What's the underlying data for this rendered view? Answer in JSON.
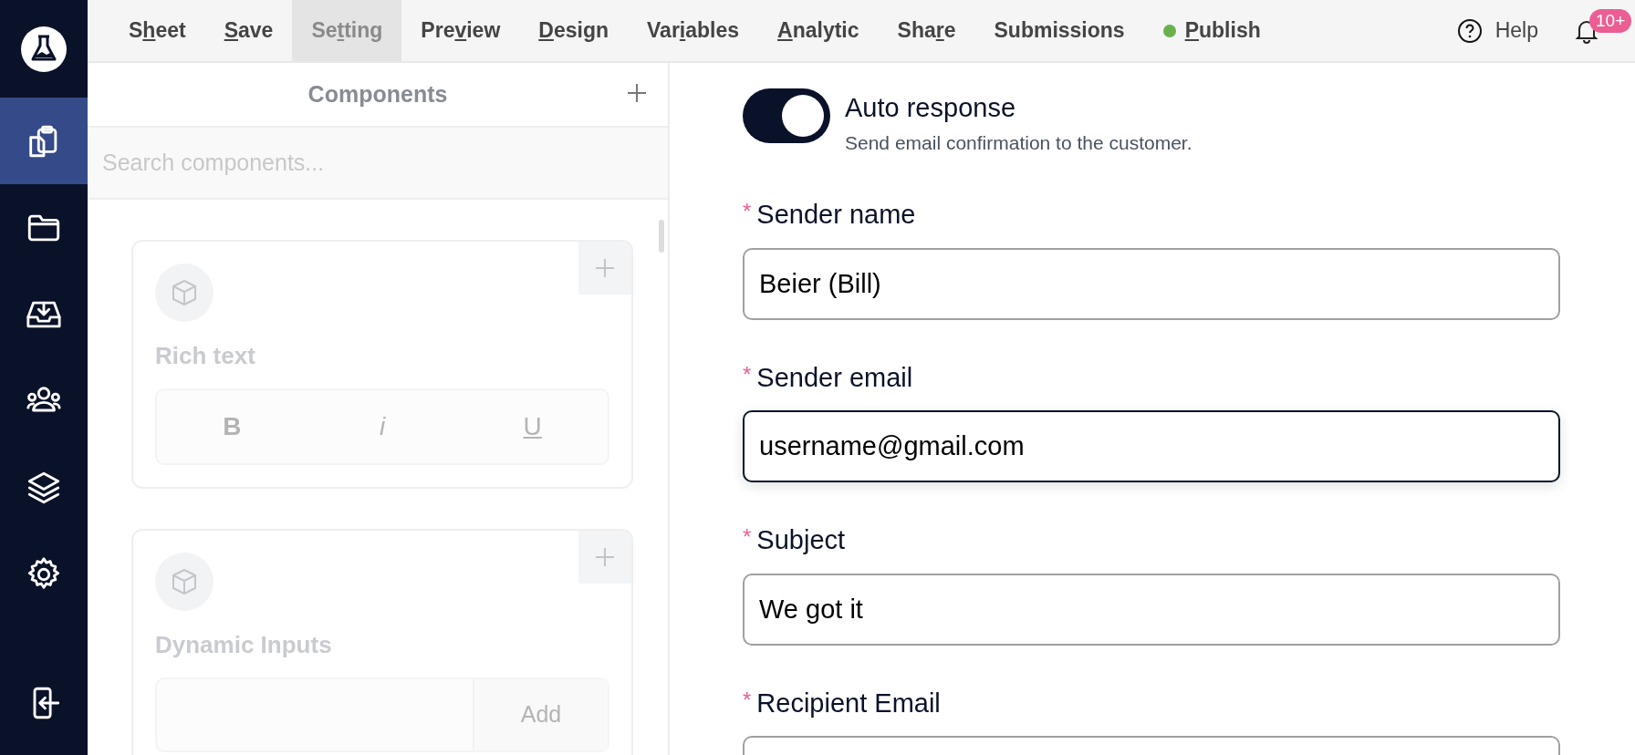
{
  "sidebar": {
    "items": [
      {
        "selected": true
      },
      {
        "selected": false
      },
      {
        "selected": false
      },
      {
        "selected": false
      },
      {
        "selected": false
      },
      {
        "selected": false
      }
    ]
  },
  "menu": [
    {
      "label_start": "S",
      "access_key": "h",
      "label_end": "eet",
      "selected": false
    },
    {
      "access_key": "S",
      "label_end": "ave",
      "selected": false
    },
    {
      "label_start": "Se",
      "access_key": "t",
      "label_end": "ting",
      "selected": true
    },
    {
      "label_start": "Pre",
      "access_key": "v",
      "label_end": "iew",
      "selected": false
    },
    {
      "access_key": "D",
      "label_end": "esign",
      "selected": false
    },
    {
      "label_start": "Var",
      "access_key": "i",
      "label_end": "ables",
      "selected": false
    },
    {
      "access_key": "A",
      "label_end": "nalytic",
      "selected": false
    },
    {
      "label_start": "Sha",
      "access_key": "r",
      "label_end": "e",
      "selected": false
    },
    {
      "label_start": "Submissions",
      "selected": false
    },
    {
      "access_key": "P",
      "label_end": "ublish",
      "selected": false,
      "color": "#6ab04c"
    }
  ],
  "help": {
    "label": "Help"
  },
  "notifications": {
    "badge": "10+"
  },
  "components_panel": {
    "title": "Components",
    "search": {
      "placeholder": "Search components..."
    },
    "cards": [
      {
        "kind": "rich_text",
        "title": "Rich text",
        "buttons": [
          "B",
          "i",
          "U"
        ]
      },
      {
        "kind": "dynamic_inputs",
        "title": "Dynamic Inputs",
        "button": "Add"
      }
    ]
  },
  "form": {
    "auto_response": {
      "on": true,
      "label": "Auto response",
      "description": "Send email confirmation to the customer."
    },
    "fields": [
      {
        "required_mark": "*",
        "label": "Sender name",
        "value": "Beier (Bill)",
        "focused": false
      },
      {
        "required_mark": "*",
        "label": "Sender email",
        "value": "username@gmail.com",
        "focused": true
      },
      {
        "required_mark": "*",
        "label": "Subject",
        "value": "We got it",
        "focused": false
      },
      {
        "required_mark": "*",
        "label": "Recipient Email",
        "focused": false
      }
    ]
  }
}
